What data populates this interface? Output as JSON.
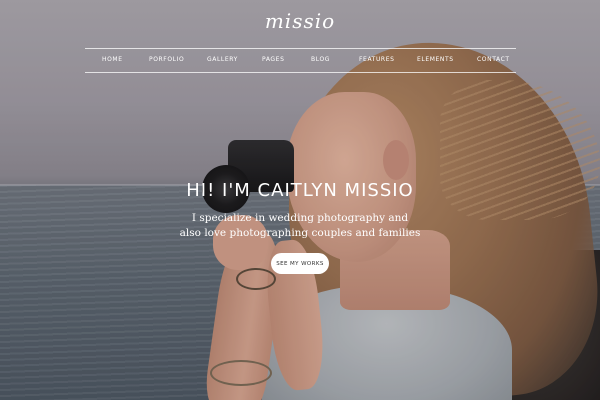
{
  "header": {
    "logo": "missio",
    "nav": [
      "HOME",
      "PORFOLIO",
      "GALLERY",
      "PAGES",
      "BLOG",
      "FEATURES",
      "ELEMENTS",
      "CONTACT"
    ]
  },
  "hero": {
    "title": "HI! I'M CAITLYN MISSIO",
    "subtitle_line1": "I specialize in wedding photography and",
    "subtitle_line2": "also love photographing couples and families",
    "cta_label": "SEE MY WORKS"
  }
}
